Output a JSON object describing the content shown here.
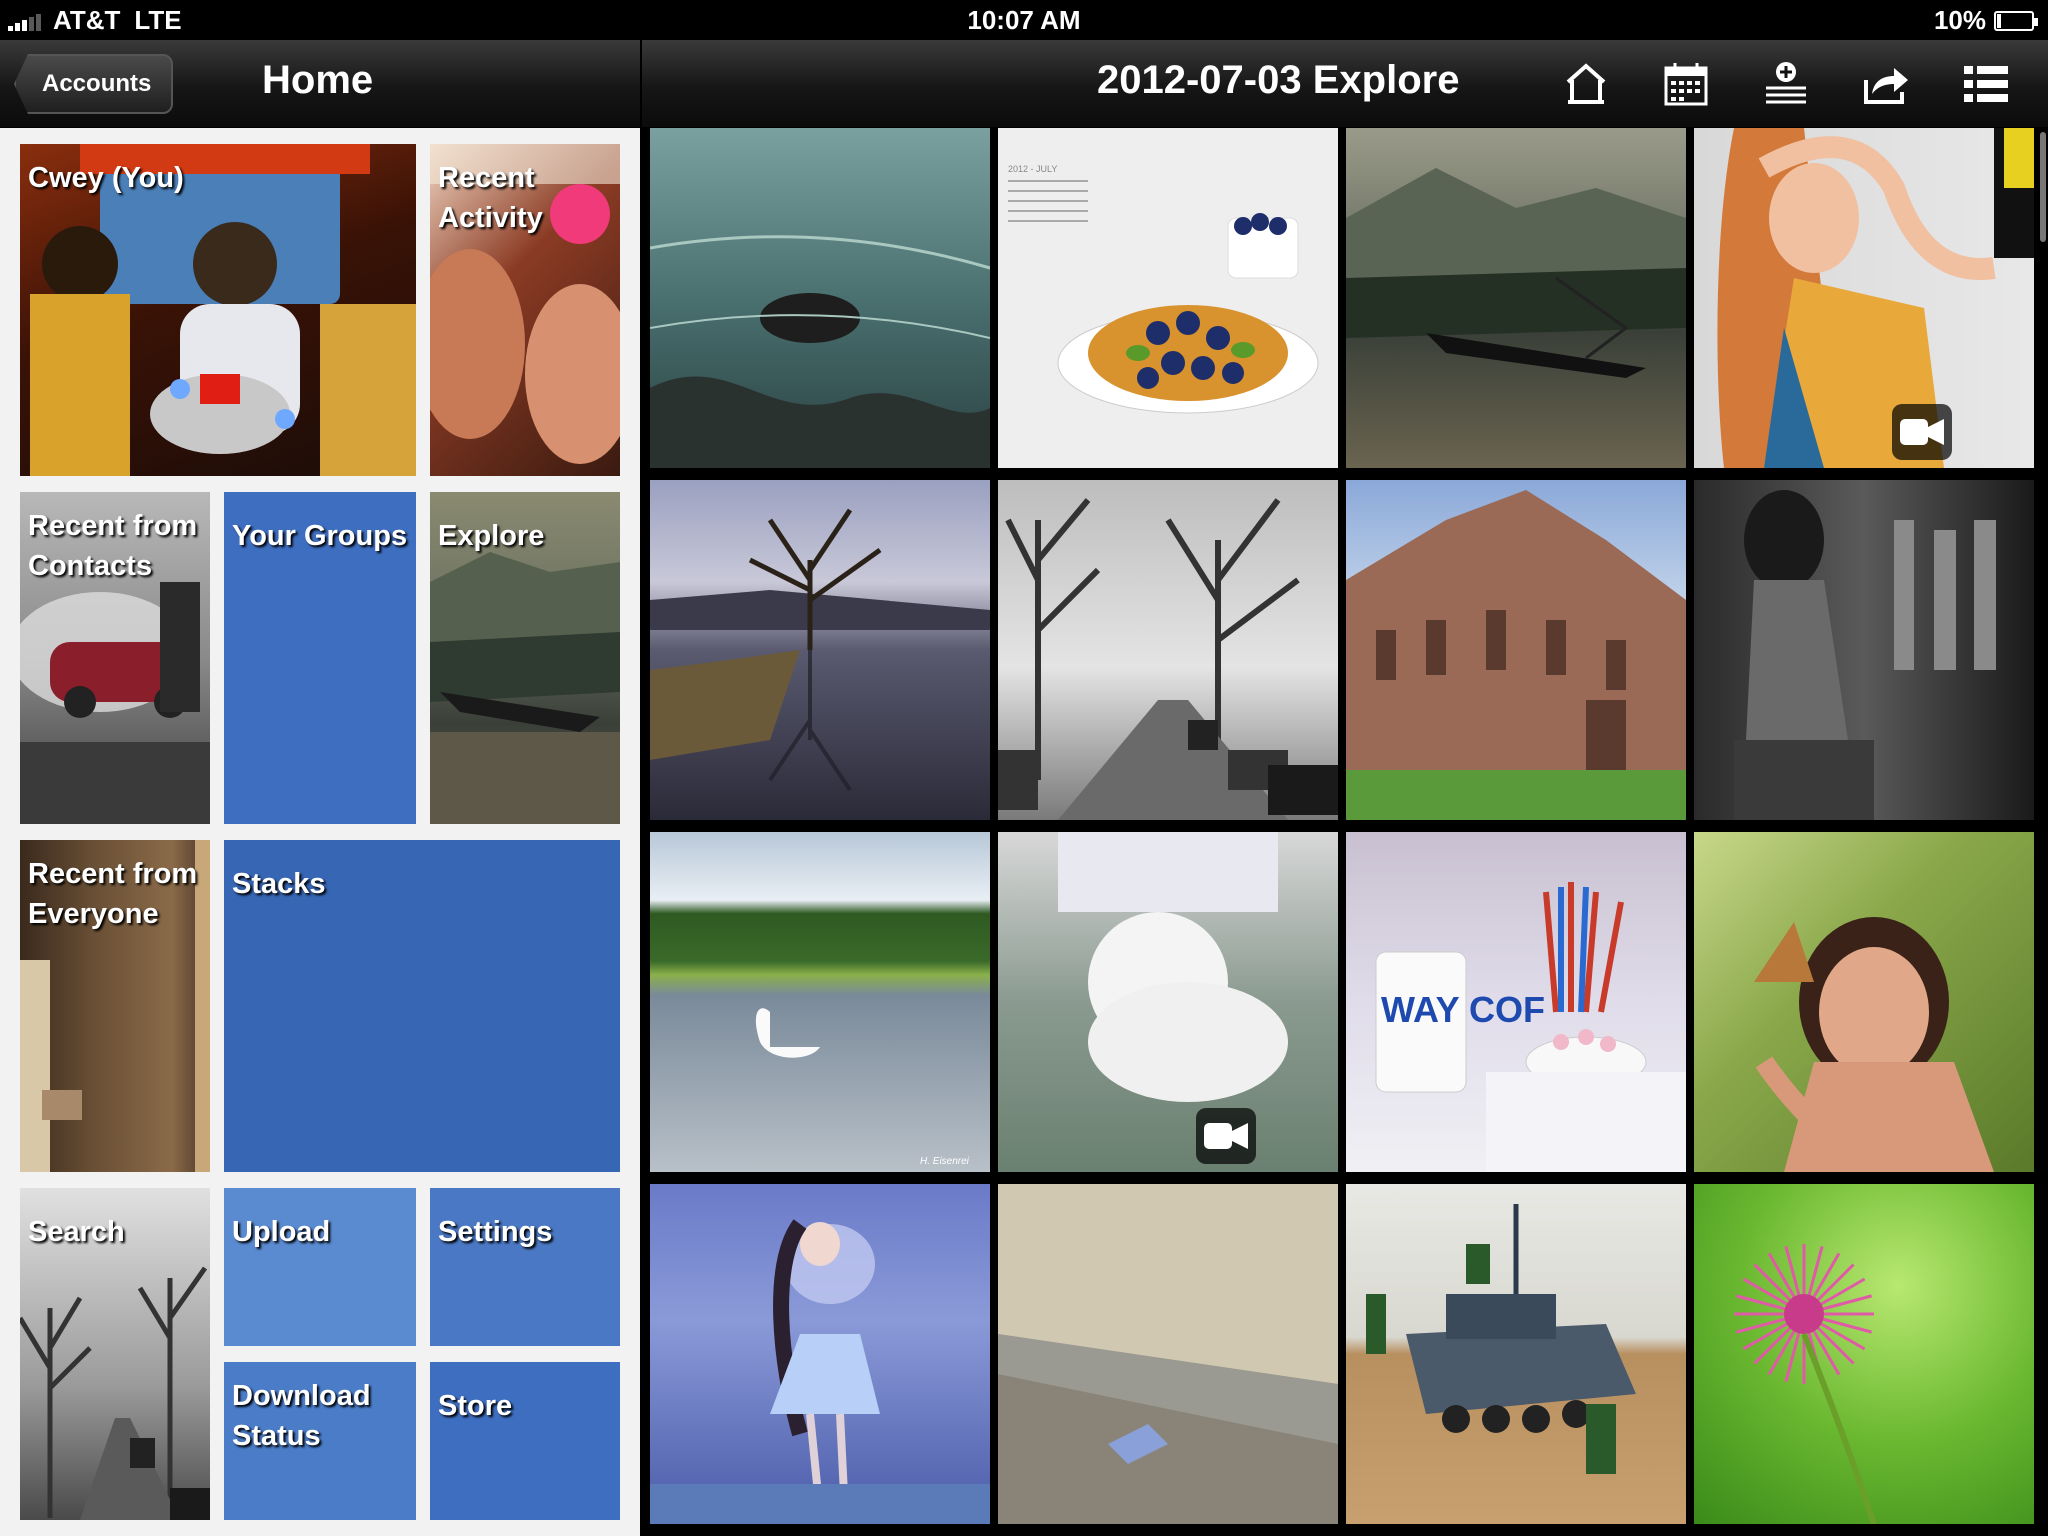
{
  "status": {
    "carrier": "AT&T",
    "network": "LTE",
    "time": "10:07 AM",
    "battery": "10%",
    "battery_level": 0.1
  },
  "left": {
    "back_label": "Accounts",
    "title": "Home",
    "tiles": {
      "you": "Cwey (You)",
      "recent_activity": "Recent\nActivity",
      "recent_contacts": "Recent from\nContacts",
      "your_groups": "Your Groups",
      "explore": "Explore",
      "recent_everyone": "Recent from\nEveryone",
      "stacks": "Stacks",
      "search": "Search",
      "upload": "Upload",
      "settings": "Settings",
      "download_status": "Download\nStatus",
      "store": "Store"
    }
  },
  "right": {
    "title": "2012-07-03 Explore",
    "toolbar": [
      "home-icon",
      "calendar-icon",
      "add-icon",
      "share-icon",
      "list-icon"
    ],
    "waffle_calendar_text": "2012 - JULY",
    "swan_credit": "H. Eisenrei",
    "cup_text": "WAY COF"
  },
  "colors": {
    "tile_blue": "#3e6ec0",
    "tile_blue_light": "#5a8ad0",
    "sidebar_bg": "#f2f2f2"
  }
}
